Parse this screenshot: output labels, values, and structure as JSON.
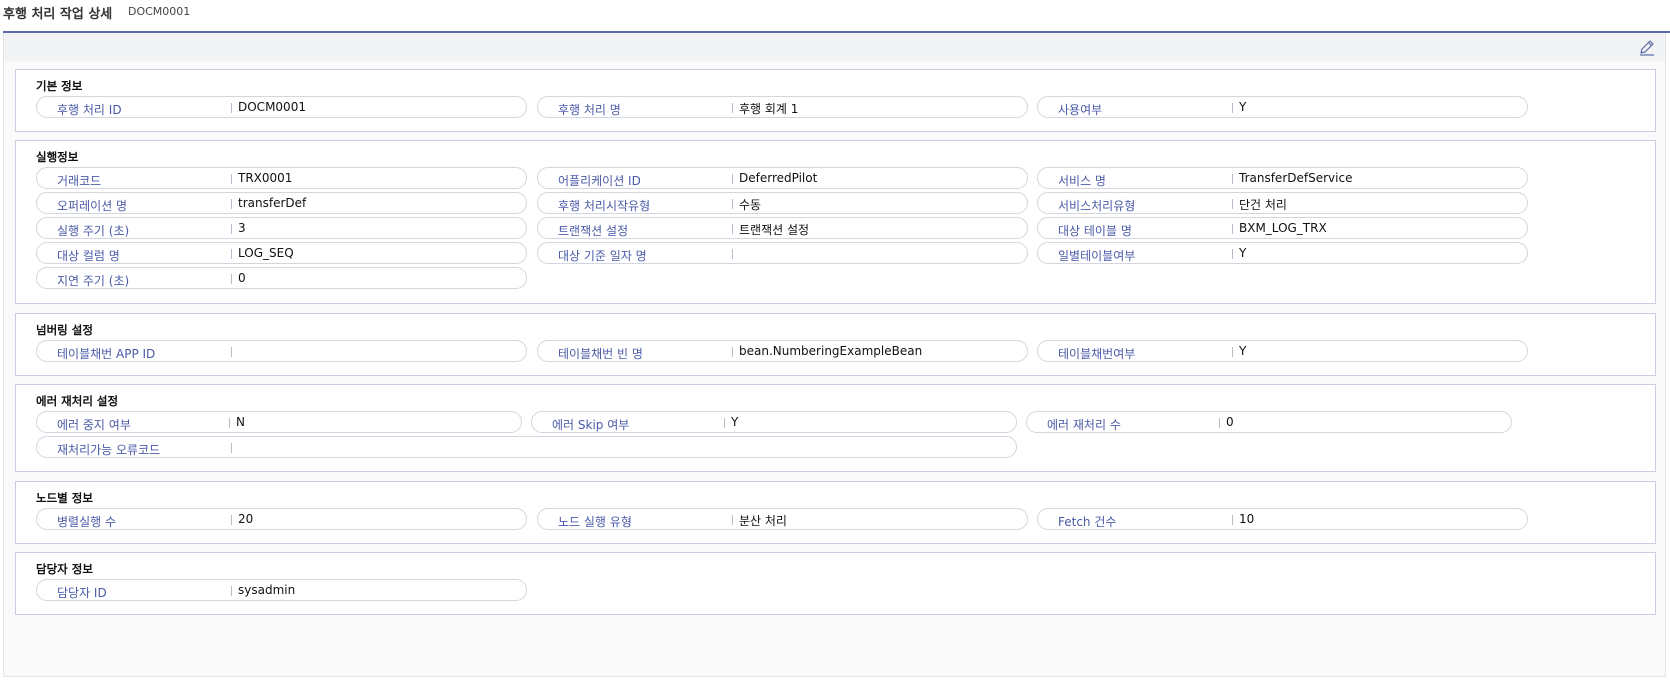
{
  "header": {
    "title": "후행 처리 작업 상세",
    "code": "DOCM0001"
  },
  "toolbar": {
    "edit_icon": "pencil-icon"
  },
  "sections": [
    {
      "title": "기본 정보",
      "fields": [
        {
          "label": "후행 처리 ID",
          "value": "DOCM0001"
        },
        {
          "label": "후행 처리 명",
          "value": "후행 회계 1"
        },
        {
          "label": "사용여부",
          "value": "Y"
        }
      ]
    },
    {
      "title": "실행정보",
      "fields": [
        {
          "label": "거래코드",
          "value": "TRX0001"
        },
        {
          "label": "어플리케이션 ID",
          "value": "DeferredPilot"
        },
        {
          "label": "서비스 명",
          "value": "TransferDefService"
        },
        {
          "label": "오퍼레이션 명",
          "value": "transferDef"
        },
        {
          "label": "후행 처리시작유형",
          "value": "수동"
        },
        {
          "label": "서비스처리유형",
          "value": "단건 처리"
        },
        {
          "label": "실행 주기 (초)",
          "value": "3"
        },
        {
          "label": "트랜잭션 설정",
          "value": "트랜잭션 설정"
        },
        {
          "label": "대상 테이블 명",
          "value": "BXM_LOG_TRX"
        },
        {
          "label": "대상 컬럼 명",
          "value": "LOG_SEQ"
        },
        {
          "label": "대상 기준 일자 명",
          "value": ""
        },
        {
          "label": "일별테이블여부",
          "value": "Y"
        },
        {
          "label": "지연 주기 (초)",
          "value": "0"
        }
      ]
    },
    {
      "title": "넘버링 설정",
      "fields": [
        {
          "label": "테이블채번 APP ID",
          "value": ""
        },
        {
          "label": "테이블채번 빈 명",
          "value": "bean.NumberingExampleBean"
        },
        {
          "label": "테이블채번여부",
          "value": "Y"
        }
      ]
    },
    {
      "title": "에러 재처리 설정",
      "fields": [
        {
          "label": "에러 중지 여부",
          "value": "N"
        },
        {
          "label": "에러 Skip 여부",
          "value": "Y"
        },
        {
          "label": "에러 재처리 수",
          "value": "0"
        },
        {
          "label": "재처리가능 오류코드",
          "value": ""
        }
      ]
    },
    {
      "title": "노드별 정보",
      "fields": [
        {
          "label": "병렬실행 수",
          "value": "20"
        },
        {
          "label": "노드 실행 유형",
          "value": "분산 처리"
        },
        {
          "label": "Fetch 건수",
          "value": "10"
        }
      ]
    },
    {
      "title": "담당자 정보",
      "fields": [
        {
          "label": "담당자 ID",
          "value": "sysadmin"
        }
      ]
    }
  ]
}
